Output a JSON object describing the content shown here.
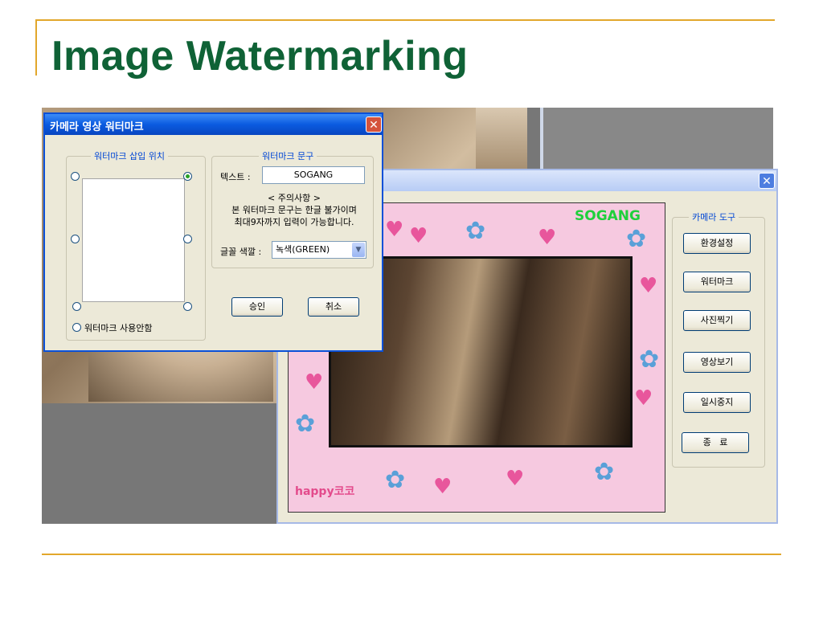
{
  "slide": {
    "title": "Image Watermarking"
  },
  "watermark_dialog": {
    "title": "카메라 영상 워터마크",
    "close_glyph": "✕",
    "position_group": {
      "label": "워터마크 삽입 위치",
      "selected": "top-right",
      "no_watermark_label": "워터마크 사용안함"
    },
    "text_group": {
      "label": "워터마크 문구",
      "text_label": "텍스트 :",
      "text_value": "SOGANG",
      "notice_title": "< 주의사항 >",
      "notice_line1": "본 워터마크 문구는 한글 불가이며",
      "notice_line2": "최대9자까지 입력이 가능합니다.",
      "color_label": "글꼴 색깔 :",
      "color_value": "녹색(GREEN)"
    },
    "ok_label": "승인",
    "cancel_label": "취소"
  },
  "camera_window": {
    "close_glyph": "✕",
    "watermark_overlay_text": "SOGANG",
    "frame_caption": "happy코코",
    "tools_group_label": "카메라 도구",
    "buttons": [
      "환경설정",
      "워터마크",
      "사진찍기",
      "영상보기",
      "일시중지",
      "종   료"
    ]
  },
  "colors": {
    "title_green": "#0f6236",
    "rule_gold": "#e2a72b",
    "xp_blue": "#0a5be0",
    "watermark_green": "#1fd03b"
  }
}
